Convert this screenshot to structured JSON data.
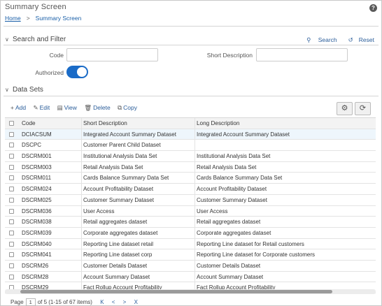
{
  "header": {
    "title": "Summary Screen",
    "breadcrumb_home": "Home",
    "breadcrumb_sep": ">",
    "breadcrumb_current": "Summary Screen",
    "help_glyph": "?"
  },
  "search_filter": {
    "section_label": "Search and Filter",
    "search_label": "Search",
    "reset_label": "Reset",
    "code_label": "Code",
    "code_value": "",
    "short_desc_label": "Short Description",
    "short_desc_value": "",
    "authorized_label": "Authorized",
    "authorized_on": true
  },
  "datasets": {
    "section_label": "Data Sets",
    "toolbar": {
      "add": "Add",
      "edit": "Edit",
      "view": "View",
      "delete": "Delete",
      "copy": "Copy"
    },
    "columns": [
      "Code",
      "Short Description",
      "Long Description"
    ],
    "rows": [
      {
        "code": "DCIACSUM",
        "short": "Integrated Account Summary Dataset",
        "long": "Integrated Account Summary Dataset"
      },
      {
        "code": "DSCPC",
        "short": "Customer Parent Child Dataset",
        "long": ""
      },
      {
        "code": "DSCRM001",
        "short": "Institutional Analysis Data Set",
        "long": "Institutional Analysis Data Set"
      },
      {
        "code": "DSCRM003",
        "short": "Retail Analysis Data Set",
        "long": "Retail Analysis Data Set"
      },
      {
        "code": "DSCRM011",
        "short": "Cards Balance Summary Data Set",
        "long": "Cards Balance Summary Data Set"
      },
      {
        "code": "DSCRM024",
        "short": "Account Profitability Dataset",
        "long": "Account Profitability Dataset"
      },
      {
        "code": "DSCRM025",
        "short": "Customer Summary Dataset",
        "long": "Customer Summary Dataset"
      },
      {
        "code": "DSCRM036",
        "short": "User Access",
        "long": "User Access"
      },
      {
        "code": "DSCRM038",
        "short": "Retail aggregates dataset",
        "long": "Retail aggregates dataset"
      },
      {
        "code": "DSCRM039",
        "short": "Corporate aggregates dataset",
        "long": "Corporate aggregates dataset"
      },
      {
        "code": "DSCRM040",
        "short": "Reporting Line dataset retail",
        "long": "Reporting Line dataset for Retail customers"
      },
      {
        "code": "DSCRM041",
        "short": "Reporting Line dataset corp",
        "long": "Reporting Line dataset for Corporate customers"
      },
      {
        "code": "DSCRM26",
        "short": "Customer Details Dataset",
        "long": "Customer Details Dataset"
      },
      {
        "code": "DSCRM28",
        "short": "Account Summary Dataset",
        "long": "Account Summary Dataset"
      },
      {
        "code": "DSCRM29",
        "short": "Fact Rollup Account Profitability",
        "long": "Fact Rollup Account Profitability"
      }
    ]
  },
  "pager": {
    "page_label": "Page",
    "page_value": "1",
    "page_info": "of 5 (1-15 of 67 items)",
    "first": "K",
    "prev": "<",
    "next": ">",
    "last": "X"
  }
}
